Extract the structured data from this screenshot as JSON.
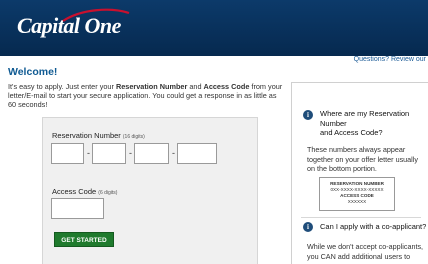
{
  "brand": {
    "name": "Capital One"
  },
  "toplinks": {
    "text": "Questions? Review our"
  },
  "welcome": {
    "title": "Welcome!"
  },
  "intro": {
    "line1_pre": "It's easy to apply. Just enter your ",
    "line1_b1": "Reservation Number",
    "line1_mid": " and ",
    "line1_b2": "Access Code",
    "line2": "from your letter/E-mail to start your secure application. You could get a response in as little as 60 seconds!"
  },
  "form": {
    "reservation_label": "Reservation Number",
    "reservation_hint": "(16 digits)",
    "reservation_values": [
      "",
      "",
      "",
      ""
    ],
    "dash": "-",
    "access_label": "Access Code",
    "access_hint": "(6 digits)",
    "access_value": "",
    "submit_label": "GET STARTED"
  },
  "help": {
    "q1_line1": "Where are my Reservation",
    "q1_line2": "Number",
    "q1_line3": "and Access Code?",
    "a1_line1": "These numbers always appear",
    "a1_line2": "together on your offer letter usually",
    "a1_line3": "on the bottom portion.",
    "sample_title": "RESERVATION NUMBER",
    "sample_number": "0XX-XXXX-XXXX-XXXXX",
    "sample_code_title": "ACCESS CODE",
    "sample_code": "XXXXXX",
    "q2": "Can I apply with a co-applicant?",
    "a2_line1": "While we don't accept co-applicants,",
    "a2_line2": "you CAN add additional users to"
  }
}
